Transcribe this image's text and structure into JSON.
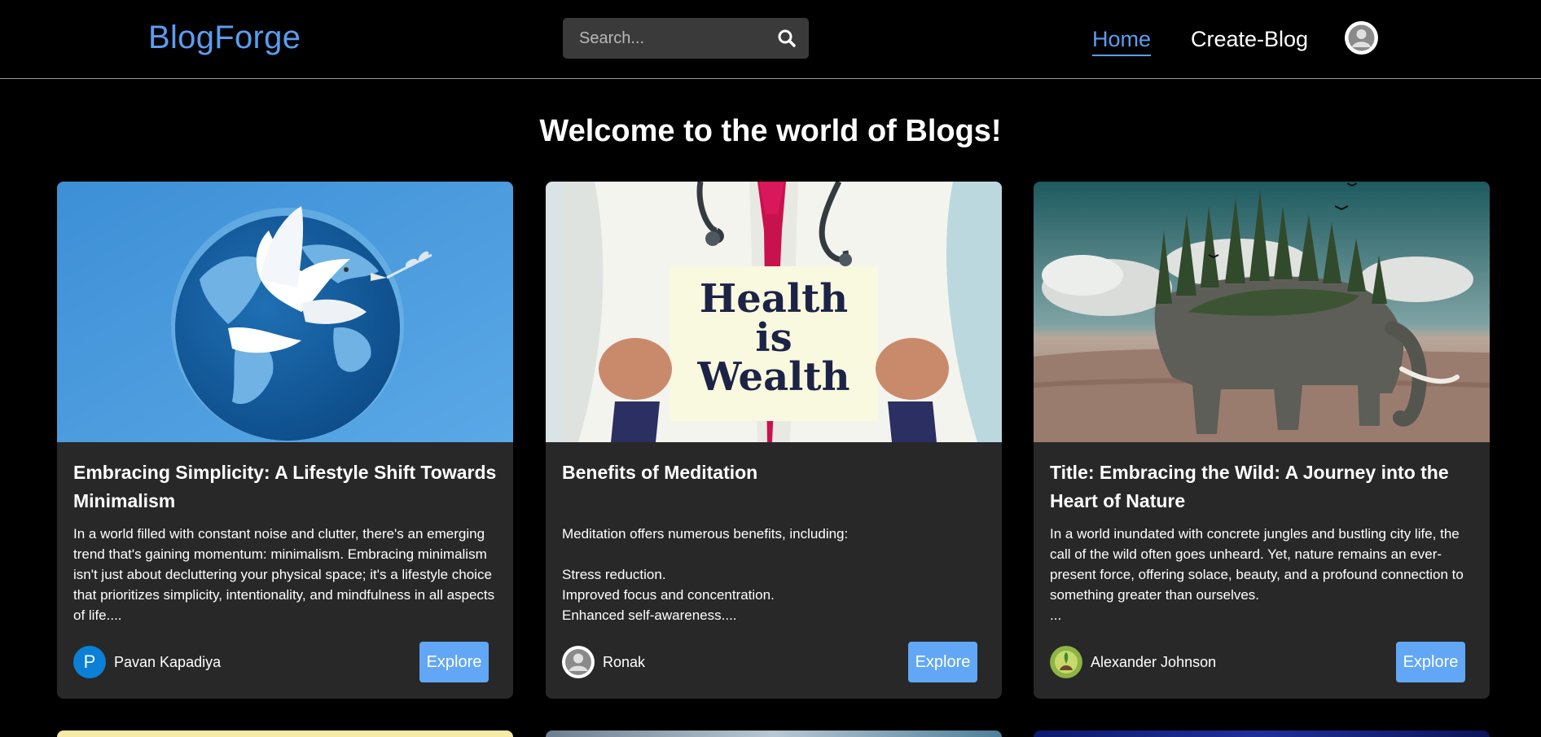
{
  "header": {
    "brand": "BlogForge",
    "search_placeholder": "Search...",
    "search_icon": "search-icon",
    "nav_home": "Home",
    "nav_create": "Create-Blog",
    "profile_icon": "user-avatar-icon"
  },
  "main": {
    "heading": "Welcome to the world of Blogs!"
  },
  "colors": {
    "accent": "#5b9cf0",
    "button": "#62a7f5",
    "card_bg": "#282828",
    "page_bg": "#000000"
  },
  "cards": [
    {
      "image_icon": "globe-dove-image",
      "title": "Embracing Simplicity: A Lifestyle Shift Towards Minimalism",
      "excerpt": "In a world filled with constant noise and clutter, there's an emerging trend that's gaining momentum: minimalism. Embracing minimalism isn't just about decluttering your physical space; it's a lifestyle choice that prioritizes simplicity, intentionality, and mindfulness in all aspects of life....",
      "author_initial": "P",
      "author": "Pavan Kapadiya",
      "button": "Explore"
    },
    {
      "image_icon": "doctor-sign-image",
      "image_text_line1": "Health",
      "image_text_line2": "is",
      "image_text_line3": "Wealth",
      "title": "Benefits of Meditation",
      "excerpt": "Meditation offers numerous benefits, including:\n\nStress reduction.\nImproved focus and concentration.\nEnhanced self-awareness....",
      "author": "Ronak",
      "button": "Explore"
    },
    {
      "image_icon": "elephant-forest-image",
      "title": "Title: Embracing the Wild: A Journey into the Heart of Nature",
      "excerpt": "In a world inundated with concrete jungles and bustling city life, the call of the wild often goes unheard. Yet, nature remains an ever-present force, offering solace, beauty, and a profound connection to something greater than ourselves.\n...",
      "author": "Alexander Johnson",
      "button": "Explore"
    }
  ]
}
